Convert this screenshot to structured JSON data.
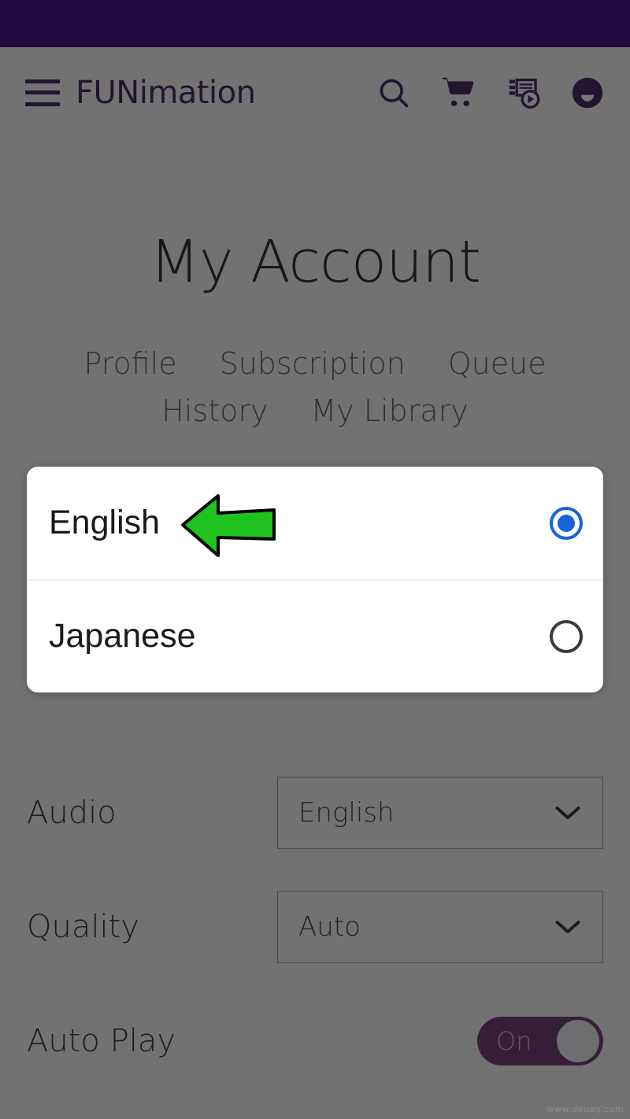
{
  "colors": {
    "status_bar": "#200a3d",
    "brand_purple": "#2b0b4e",
    "overlay_gray": "#666666",
    "radio_selected_blue": "#1565d8",
    "toggle_on_purple": "#5f1f63",
    "annotation_green": "#1fc21f"
  },
  "header": {
    "menu_icon": "hamburger-menu-icon",
    "brand": "FUNimation",
    "icons": [
      {
        "name": "search-icon",
        "label": "Search"
      },
      {
        "name": "cart-icon",
        "label": "Cart"
      },
      {
        "name": "queue-play-icon",
        "label": "Queue"
      },
      {
        "name": "avatar-icon",
        "label": "Account"
      }
    ]
  },
  "main": {
    "title": "My Account",
    "tabs_row1": [
      "Profile",
      "Subscription",
      "Queue"
    ],
    "tabs_row2": [
      "History",
      "My Library"
    ]
  },
  "settings": [
    {
      "label": "Audio",
      "control": "select",
      "value": "English",
      "chevron": "chevron-down-icon"
    },
    {
      "label": "Quality",
      "control": "select",
      "value": "Auto",
      "chevron": "chevron-down-icon"
    },
    {
      "label": "Auto Play",
      "control": "toggle",
      "value": "On"
    }
  ],
  "modal": {
    "options": [
      {
        "label": "English",
        "selected": true
      },
      {
        "label": "Japanese",
        "selected": false
      }
    ]
  },
  "annotation": {
    "type": "arrow-left",
    "points_to": "English",
    "color": "#1fc21f"
  },
  "watermark": "www.deuaq.com"
}
